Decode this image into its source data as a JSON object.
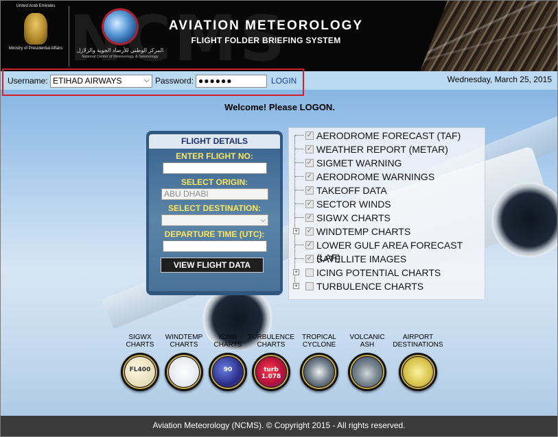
{
  "header": {
    "watermark": "NCMS",
    "emblem_top": "United Arab Emirates",
    "emblem_bottom": "Ministry of Presidential Affairs",
    "ncms_arabic": "المركز الوطني للأرصاد الجوية والزلازل",
    "ncms_english": "National Center of Meteorology & Seismology",
    "title": "AVIATION METEOROLOGY",
    "subtitle": "FLIGHT FOLDER BRIEFING SYSTEM"
  },
  "login": {
    "username_label": "Username:",
    "username_value": "ETIHAD AIRWAYS",
    "password_label": "Password:",
    "password_value": "●●●●●●",
    "login_link": "LOGIN",
    "date": "Wednesday, March 25, 2015"
  },
  "welcome": "Welcome! Please LOGON.",
  "flight_details": {
    "heading": "FLIGHT DETAILS",
    "flight_no_label": "ENTER FLIGHT NO:",
    "flight_no_value": "",
    "origin_label": "SELECT ORIGIN:",
    "origin_value": "ABU DHABI",
    "destination_label": "SELECT DESTINATION:",
    "destination_value": "",
    "departure_label": "DEPARTURE TIME (UTC):",
    "departure_value": "",
    "view_button": "VIEW FLIGHT DATA"
  },
  "checklist": [
    {
      "label": "AERODROME FORECAST (TAF)",
      "checked": true,
      "expand": false
    },
    {
      "label": "WEATHER REPORT (METAR)",
      "checked": true,
      "expand": false
    },
    {
      "label": "SIGMET WARNING",
      "checked": true,
      "expand": false
    },
    {
      "label": "AERODROME WARNINGS",
      "checked": true,
      "expand": false
    },
    {
      "label": "TAKEOFF DATA",
      "checked": true,
      "expand": false
    },
    {
      "label": "SECTOR WINDS",
      "checked": true,
      "expand": false
    },
    {
      "label": "SIGWX CHARTS",
      "checked": true,
      "expand": false
    },
    {
      "label": "WINDTEMP CHARTS",
      "checked": true,
      "expand": true
    },
    {
      "label": "LOWER GULF AREA FORECAST (LAF)",
      "checked": true,
      "expand": false
    },
    {
      "label": "SATELLITE IMAGES",
      "checked": true,
      "expand": false
    },
    {
      "label": "ICING POTENTIAL CHARTS",
      "checked": false,
      "expand": true
    },
    {
      "label": "TURBULENCE CHARTS",
      "checked": false,
      "expand": true
    }
  ],
  "charts": [
    {
      "line1": "SIGWX",
      "line2": "CHARTS",
      "icon": "sigwx-icon",
      "badge": "FL400"
    },
    {
      "line1": "WINDTEMP",
      "line2": "CHARTS",
      "icon": "windtemp-icon",
      "badge": ""
    },
    {
      "line1": "ICING",
      "line2": "CHARTS",
      "icon": "icing-icon",
      "badge": "90"
    },
    {
      "line1": "TURBULENCE",
      "line2": "CHARTS",
      "icon": "turbulence-icon",
      "badge": "turb 1.078"
    },
    {
      "line1": "TROPICAL",
      "line2": "CYCLONE",
      "icon": "cyclone-icon",
      "badge": ""
    },
    {
      "line1": "VOLCANIC",
      "line2": "ASH",
      "icon": "volcano-icon",
      "badge": ""
    },
    {
      "line1": "AIRPORT",
      "line2": "DESTINATIONS",
      "icon": "airport-icon",
      "badge": ""
    }
  ],
  "footer": "Aviation Meteorology (NCMS). © Copyright 2015 - All rights reserved.",
  "colors": {
    "header_bg": "#070707",
    "login_bar_bg": "#b9daf2",
    "highlight_border": "#d21f2a",
    "panel_label_yellow": "#ffe75a",
    "panel_bg": "#30577f",
    "footer_bg": "#3b3b3b",
    "link_blue": "#1b3f9e"
  }
}
